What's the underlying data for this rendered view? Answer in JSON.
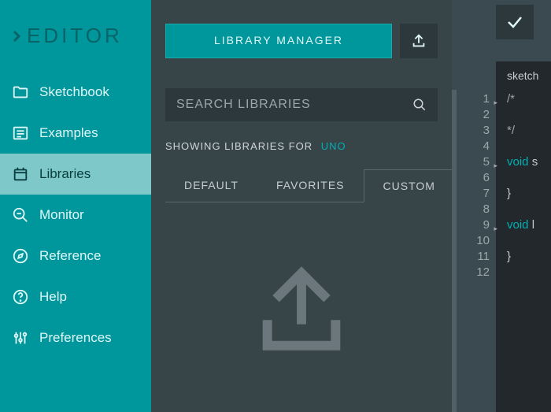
{
  "app": {
    "title": "EDITOR"
  },
  "sidebar": {
    "items": [
      {
        "label": "Sketchbook"
      },
      {
        "label": "Examples"
      },
      {
        "label": "Libraries"
      },
      {
        "label": "Monitor"
      },
      {
        "label": "Reference"
      },
      {
        "label": "Help"
      },
      {
        "label": "Preferences"
      }
    ]
  },
  "panel": {
    "library_manager_label": "LIBRARY MANAGER",
    "search_placeholder": "SEARCH LIBRARIES",
    "showing_prefix": "SHOWING LIBRARIES FOR",
    "board": "UNO",
    "tabs": {
      "default": "DEFAULT",
      "favorites": "FAVORITES",
      "custom": "CUSTOM"
    }
  },
  "code": {
    "top_word": "sket",
    "file_tab": "sketch",
    "lines": [
      "/*",
      "",
      "*/",
      "",
      "void s",
      "",
      "}",
      "",
      "void l",
      "",
      "}",
      ""
    ],
    "line_numbers": [
      "1",
      "2",
      "3",
      "4",
      "5",
      "6",
      "7",
      "8",
      "9",
      "10",
      "11",
      "12"
    ],
    "fold_lines": [
      1,
      5,
      9
    ]
  }
}
